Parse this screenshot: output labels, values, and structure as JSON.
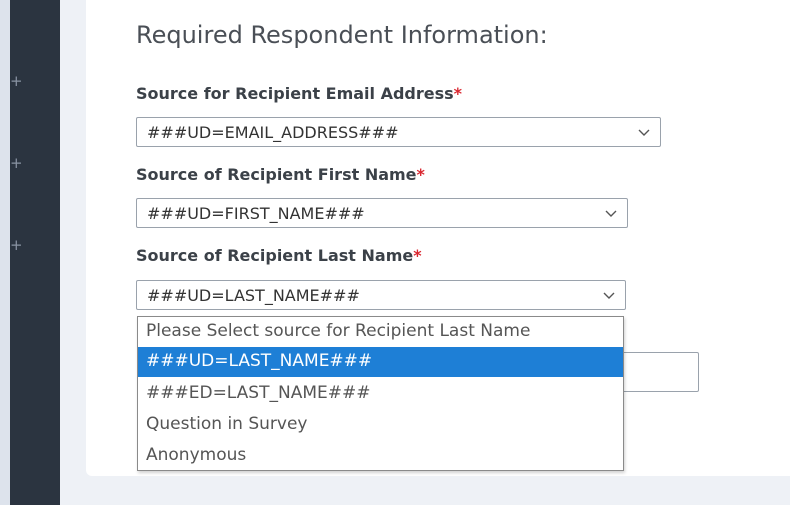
{
  "section": {
    "title": "Required Respondent Information:"
  },
  "sidebar": {
    "expand_icons": [
      "plus-icon",
      "plus-icon",
      "plus-icon"
    ]
  },
  "fields": {
    "email": {
      "label": "Source for Recipient Email Address",
      "required_mark": "*",
      "value": "###UD=EMAIL_ADDRESS###"
    },
    "first_name": {
      "label": "Source of Recipient First Name",
      "required_mark": "*",
      "value": "###UD=FIRST_NAME###"
    },
    "last_name": {
      "label": "Source of Recipient Last Name",
      "required_mark": "*",
      "value": "###UD=LAST_NAME###"
    }
  },
  "dropdown": {
    "options": [
      "Please Select source for Recipient Last Name",
      "###UD=LAST_NAME###",
      "###ED=LAST_NAME###",
      "Question in Survey",
      "Anonymous"
    ],
    "selected_value": "###UD=LAST_NAME###"
  },
  "colors": {
    "sidebar": "#2b3440",
    "required": "#d9262f",
    "highlight": "#1e7fd6"
  }
}
